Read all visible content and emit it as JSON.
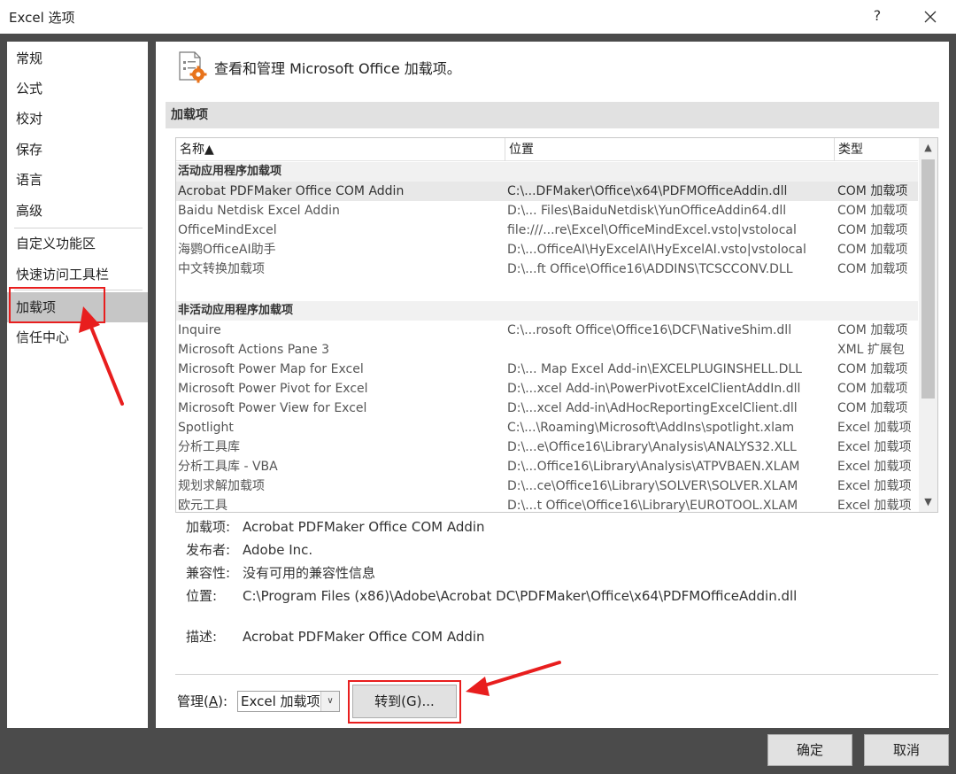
{
  "window": {
    "title": "Excel 选项",
    "help": "?"
  },
  "sidebar": {
    "items": [
      {
        "label": "常规"
      },
      {
        "label": "公式"
      },
      {
        "label": "校对"
      },
      {
        "label": "保存"
      },
      {
        "label": "语言"
      },
      {
        "label": "高级"
      },
      {
        "label": "自定义功能区"
      },
      {
        "label": "快速访问工具栏"
      },
      {
        "label": "加载项"
      },
      {
        "label": "信任中心"
      }
    ],
    "selected": "加载项"
  },
  "main": {
    "header": "查看和管理 Microsoft Office 加载项。",
    "section_title": "加载项",
    "columns": {
      "name": "名称▲",
      "location": "位置",
      "type": "类型"
    },
    "groups": [
      {
        "title": "活动应用程序加载项",
        "rows": [
          {
            "name": "Acrobat PDFMaker Office COM Addin",
            "location": "C:\\...DFMaker\\Office\\x64\\PDFMOfficeAddin.dll",
            "type": "COM 加载项"
          },
          {
            "name": "Baidu Netdisk Excel Addin",
            "location": "D:\\... Files\\BaiduNetdisk\\YunOfficeAddin64.dll",
            "type": "COM 加载项"
          },
          {
            "name": "OfficeMindExcel",
            "location": "file:///...re\\Excel\\OfficeMindExcel.vsto|vstolocal",
            "type": "COM 加载项"
          },
          {
            "name": "海鹦OfficeAI助手",
            "location": "D:\\...OfficeAI\\HyExcelAI\\HyExcelAI.vsto|vstolocal",
            "type": "COM 加载项"
          },
          {
            "name": "中文转换加载项",
            "location": "D:\\...ft Office\\Office16\\ADDINS\\TCSCCONV.DLL",
            "type": "COM 加载项"
          }
        ]
      },
      {
        "title": "非活动应用程序加载项",
        "rows": [
          {
            "name": "Inquire",
            "location": "C:\\...rosoft Office\\Office16\\DCF\\NativeShim.dll",
            "type": "COM 加载项"
          },
          {
            "name": "Microsoft Actions Pane 3",
            "location": "",
            "type": "XML 扩展包"
          },
          {
            "name": "Microsoft Power Map for Excel",
            "location": "D:\\... Map Excel Add-in\\EXCELPLUGINSHELL.DLL",
            "type": "COM 加载项"
          },
          {
            "name": "Microsoft Power Pivot for Excel",
            "location": "D:\\...xcel Add-in\\PowerPivotExcelClientAddIn.dll",
            "type": "COM 加载项"
          },
          {
            "name": "Microsoft Power View for Excel",
            "location": "D:\\...xcel Add-in\\AdHocReportingExcelClient.dll",
            "type": "COM 加载项"
          },
          {
            "name": "Spotlight",
            "location": "C:\\...\\Roaming\\Microsoft\\AddIns\\spotlight.xlam",
            "type": "Excel 加载项"
          },
          {
            "name": "分析工具库",
            "location": "D:\\...e\\Office16\\Library\\Analysis\\ANALYS32.XLL",
            "type": "Excel 加载项"
          },
          {
            "name": "分析工具库 - VBA",
            "location": "D:\\...Office16\\Library\\Analysis\\ATPVBAEN.XLAM",
            "type": "Excel 加载项"
          },
          {
            "name": "规划求解加载项",
            "location": "D:\\...ce\\Office16\\Library\\SOLVER\\SOLVER.XLAM",
            "type": "Excel 加载项"
          },
          {
            "name": "欧元工具",
            "location": "D:\\...t Office\\Office16\\Library\\EUROTOOL.XLAM",
            "type": "Excel 加载项"
          }
        ]
      }
    ],
    "details": {
      "addin_label": "加载项:",
      "addin_value": "Acrobat PDFMaker Office COM Addin",
      "publisher_label": "发布者:",
      "publisher_value": "Adobe Inc.",
      "compat_label": "兼容性:",
      "compat_value": "没有可用的兼容性信息",
      "location_label": "位置:",
      "location_value": "C:\\Program Files (x86)\\Adobe\\Acrobat DC\\PDFMaker\\Office\\x64\\PDFMOfficeAddin.dll",
      "desc_label": "描述:",
      "desc_value": "Acrobat PDFMaker Office COM Addin"
    },
    "manage": {
      "label_prefix": "管理(",
      "label_key": "A",
      "label_suffix": "):",
      "selected": "Excel 加载项",
      "go_button": "转到(G)..."
    }
  },
  "footer": {
    "ok": "确定",
    "cancel": "取消"
  },
  "colors": {
    "highlight": "#e81e1e",
    "selected_sidebar": "#c6c6c6",
    "icon_orange": "#e8731b"
  }
}
